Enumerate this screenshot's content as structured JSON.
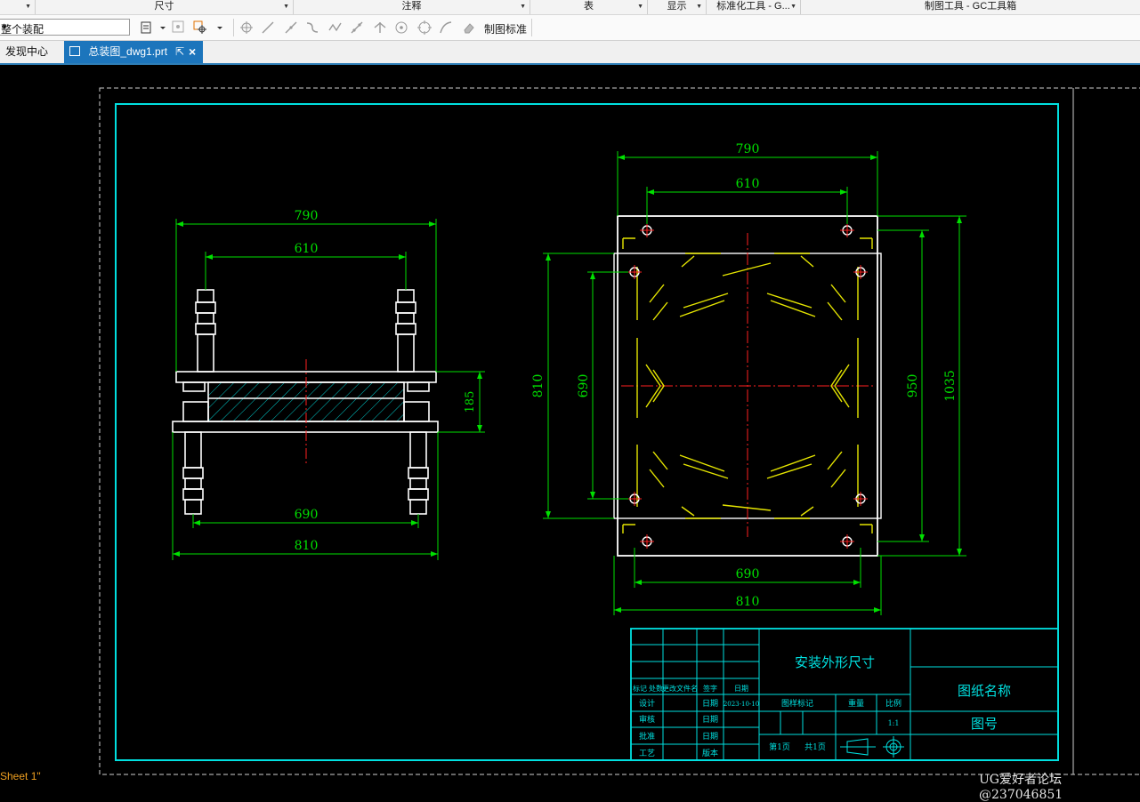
{
  "ribbon": {
    "groups": [
      {
        "label": "尺寸"
      },
      {
        "label": "注释"
      },
      {
        "label": "表"
      },
      {
        "label": "显示"
      },
      {
        "label": "标准化工具 - G..."
      },
      {
        "label": "制图工具 - GC工具箱"
      }
    ]
  },
  "toolbar": {
    "filter_value": "整个装配",
    "drafting_standard_label": "制图标准"
  },
  "tabs": [
    {
      "label": "发现中心"
    },
    {
      "label": "总装图_dwg1.prt"
    }
  ],
  "drawing": {
    "front_view": {
      "dim_top_outer": "790",
      "dim_top_inner": "610",
      "dim_height": "185",
      "dim_bottom_inner": "690",
      "dim_bottom_outer": "810"
    },
    "plan_view": {
      "dim_top_outer": "790",
      "dim_top_inner": "610",
      "dim_left_outer": "810",
      "dim_left_inner": "690",
      "dim_right_inner": "950",
      "dim_right_outer": "1035",
      "dim_bottom_inner": "690",
      "dim_bottom_outer": "810"
    },
    "title_block": {
      "title": "安装外形尺寸",
      "drawing_name": "图纸名称",
      "drawing_no": "图号",
      "col_headers": [
        "标记",
        "处数",
        "更改文件名",
        "签字",
        "日期"
      ],
      "rows": [
        {
          "role": "设计",
          "date_label": "日期",
          "date_value": "2023-10-10"
        },
        {
          "role": "审核",
          "date_label": "日期",
          "date_value": ""
        },
        {
          "role": "批准",
          "date_label": "日期",
          "date_value": ""
        },
        {
          "role": "工艺",
          "date_label": "版本",
          "date_value": ""
        }
      ],
      "stage_mark_label": "图样标记",
      "weight_label": "重量",
      "scale_label": "比例",
      "scale_value": "1:1",
      "sheet_info": "第1页",
      "total_sheets": "共1页"
    }
  },
  "status": {
    "sheet_label": "Sheet 1\"",
    "watermark": "UG爱好者论坛@237046851"
  },
  "colors": {
    "frame": "#00e0e0",
    "dimension": "#00e000",
    "outline": "#ffffff",
    "center": "#ff2020",
    "hidden": "#e6e600",
    "hatch": "#00c8c8",
    "tab_active": "#1c75bc"
  }
}
